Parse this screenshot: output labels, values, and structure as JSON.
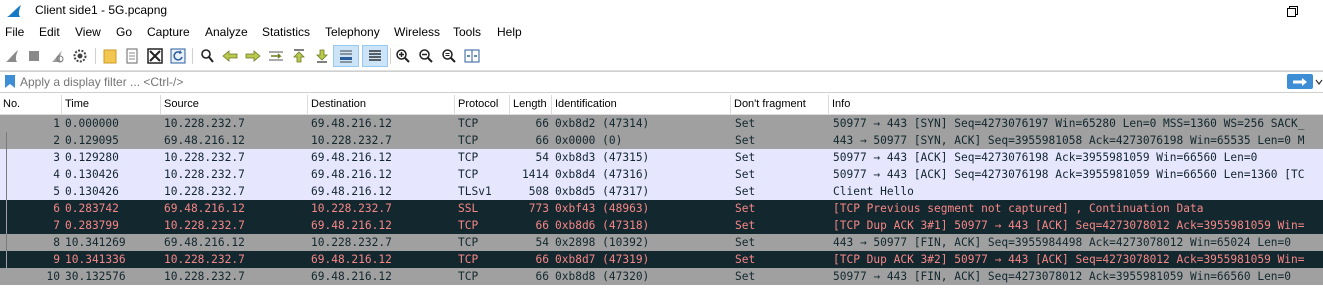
{
  "window": {
    "title": "Client side1 - 5G.pcapng"
  },
  "menu": [
    "File",
    "Edit",
    "View",
    "Go",
    "Capture",
    "Analyze",
    "Statistics",
    "Telephony",
    "Wireless",
    "Tools",
    "Help"
  ],
  "filter": {
    "placeholder": "Apply a display filter ... <Ctrl-/>"
  },
  "columns": [
    "No.",
    "Time",
    "Source",
    "Destination",
    "Protocol",
    "Length",
    "Identification",
    "Don't fragment",
    "Info"
  ],
  "colors": {
    "gray_bg": "#a0a0a0",
    "lavender_bg": "#e7e6ff",
    "black_bg": "#12272e",
    "black_fg": "#f78787",
    "normal_fg": "#12272e"
  },
  "packets": [
    {
      "no": "1",
      "time": "0.000000",
      "src": "10.228.232.7",
      "dst": "69.48.216.12",
      "proto": "TCP",
      "len": "66",
      "ident": "0xb8d2 (47314)",
      "df": "Set",
      "info": "50977 → 443 [SYN] Seq=4273076197 Win=65280 Len=0 MSS=1360 WS=256 SACK_",
      "style": "gray"
    },
    {
      "no": "2",
      "time": "0.129095",
      "src": "69.48.216.12",
      "dst": "10.228.232.7",
      "proto": "TCP",
      "len": "66",
      "ident": "0x0000 (0)",
      "df": "Set",
      "info": "443 → 50977 [SYN, ACK] Seq=3955981058 Ack=4273076198 Win=65535 Len=0 M",
      "style": "gray"
    },
    {
      "no": "3",
      "time": "0.129280",
      "src": "10.228.232.7",
      "dst": "69.48.216.12",
      "proto": "TCP",
      "len": "54",
      "ident": "0xb8d3 (47315)",
      "df": "Set",
      "info": "50977 → 443 [ACK] Seq=4273076198 Ack=3955981059 Win=66560 Len=0",
      "style": "lavender"
    },
    {
      "no": "4",
      "time": "0.130426",
      "src": "10.228.232.7",
      "dst": "69.48.216.12",
      "proto": "TCP",
      "len": "1414",
      "ident": "0xb8d4 (47316)",
      "df": "Set",
      "info": "50977 → 443 [ACK] Seq=4273076198 Ack=3955981059 Win=66560 Len=1360 [TC",
      "style": "lavender"
    },
    {
      "no": "5",
      "time": "0.130426",
      "src": "10.228.232.7",
      "dst": "69.48.216.12",
      "proto": "TLSv1",
      "len": "508",
      "ident": "0xb8d5 (47317)",
      "df": "Set",
      "info": "Client Hello",
      "style": "lavender"
    },
    {
      "no": "6",
      "time": "0.283742",
      "src": "69.48.216.12",
      "dst": "10.228.232.7",
      "proto": "SSL",
      "len": "773",
      "ident": "0xbf43 (48963)",
      "df": "Set",
      "info": "[TCP Previous segment not captured] , Continuation Data",
      "style": "black"
    },
    {
      "no": "7",
      "time": "0.283799",
      "src": "10.228.232.7",
      "dst": "69.48.216.12",
      "proto": "TCP",
      "len": "66",
      "ident": "0xb8d6 (47318)",
      "df": "Set",
      "info": "[TCP Dup ACK 3#1] 50977 → 443 [ACK] Seq=4273078012 Ack=3955981059 Win=",
      "style": "black"
    },
    {
      "no": "8",
      "time": "10.341269",
      "src": "69.48.216.12",
      "dst": "10.228.232.7",
      "proto": "TCP",
      "len": "54",
      "ident": "0x2898 (10392)",
      "df": "Set",
      "info": "443 → 50977 [FIN, ACK] Seq=3955984498 Ack=4273078012 Win=65024 Len=0",
      "style": "gray"
    },
    {
      "no": "9",
      "time": "10.341336",
      "src": "10.228.232.7",
      "dst": "69.48.216.12",
      "proto": "TCP",
      "len": "66",
      "ident": "0xb8d7 (47319)",
      "df": "Set",
      "info": "[TCP Dup ACK 3#2] 50977 → 443 [ACK] Seq=4273078012 Ack=3955981059 Win=",
      "style": "black"
    },
    {
      "no": "10",
      "time": "30.132576",
      "src": "10.228.232.7",
      "dst": "69.48.216.12",
      "proto": "TCP",
      "len": "66",
      "ident": "0xb8d8 (47320)",
      "df": "Set",
      "info": "50977 → 443 [FIN, ACK] Seq=4273078012 Ack=3955981059 Win=66560 Len=0",
      "style": "gray"
    }
  ],
  "toolbar_icons": [
    "shark-fin-start-icon",
    "stop-icon",
    "restart-icon",
    "options-gear-icon",
    "open-folder-icon",
    "file-icon",
    "close-file-icon",
    "reload-icon",
    "find-icon",
    "back-arrow-icon",
    "forward-arrow-icon",
    "go-to-packet-icon",
    "first-packet-icon",
    "last-packet-icon",
    "autoscroll-icon",
    "colorize-icon",
    "zoom-in-icon",
    "zoom-out-icon",
    "normal-size-icon",
    "resize-columns-icon"
  ]
}
